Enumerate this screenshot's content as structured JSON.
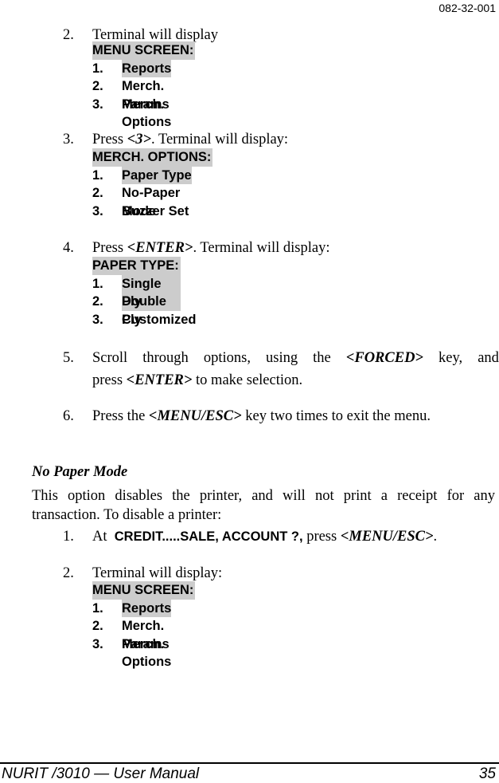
{
  "header": {
    "doc_number": "082-32-001"
  },
  "steps_a": [
    {
      "num": "2.",
      "text": "Terminal will display",
      "screen": {
        "title": "MENU SCREEN:",
        "items": [
          {
            "num": "1.",
            "label": "Reports",
            "highlighted": true
          },
          {
            "num": "2.",
            "label": "Merch. Params"
          },
          {
            "num": "3.",
            "label": "Merch. Options"
          }
        ]
      }
    },
    {
      "num": "3.",
      "pre": "Press ",
      "key": "<3>",
      "post": ". Terminal will display:",
      "screen": {
        "title": "MERCH. OPTIONS:",
        "items": [
          {
            "num": "1.",
            "label": "Paper Type",
            "highlighted": true
          },
          {
            "num": "2.",
            "label": "No-Paper Mode"
          },
          {
            "num": "3.",
            "label": "Buzzer Set"
          }
        ]
      }
    },
    {
      "num": "4.",
      "pre": "Press ",
      "key": "<ENTER>",
      "post": ". Terminal will display:",
      "screen": {
        "title": "PAPER TYPE:",
        "items": [
          {
            "num": "1.",
            "label": "Single Ply",
            "highlighted": true
          },
          {
            "num": "2.",
            "label": "Double Ply"
          },
          {
            "num": "3.",
            "label": "Customized"
          }
        ]
      }
    },
    {
      "num": "5.",
      "line1": [
        "Scroll",
        "through",
        "options,",
        "using",
        "the",
        "<FORCED>",
        "key,",
        "and"
      ],
      "line2_pre": "press ",
      "line2_key": "<ENTER>",
      "line2_post": " to make selection."
    },
    {
      "num": "6.",
      "pre": "Press the ",
      "key": "<MENU/ESC>",
      "post": " key two times to exit the menu."
    }
  ],
  "section": {
    "heading": "No Paper Mode",
    "paragraph": "This option disables the printer, and will not print a receipt for any transaction.  To disable a printer:",
    "steps": [
      {
        "num": "1.",
        "pre": "At  ",
        "prompt": "CREDIT.....SALE, ACCOUNT ?,",
        "mid": " press ",
        "key": "<MENU/ESC>",
        "post": "."
      },
      {
        "num": "2.",
        "text": "Terminal will display:",
        "screen": {
          "title": "MENU SCREEN:",
          "items": [
            {
              "num": "1.",
              "label": "Reports",
              "highlighted": true
            },
            {
              "num": "2.",
              "label": "Merch. Params"
            },
            {
              "num": "3.",
              "label": "Merch. Options"
            }
          ]
        }
      }
    ]
  },
  "footer": {
    "manual_title": "NURIT /3010 — User Manual",
    "page_number": "35"
  }
}
